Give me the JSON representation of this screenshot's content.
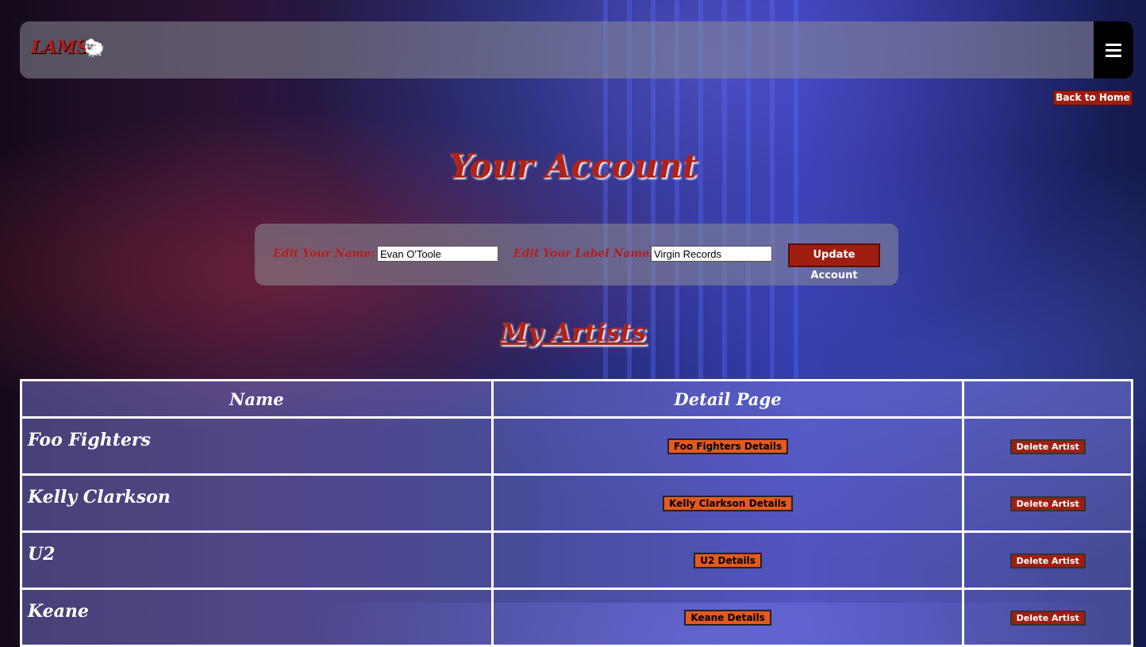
{
  "header": {
    "brand": "LAMS",
    "brand_icon": "sheep-icon",
    "back_label": "Back to Home"
  },
  "page": {
    "title": "Your Account",
    "section_title": "My Artists"
  },
  "form": {
    "name_label": "Edit Your Name:",
    "name_value": "Evan O'Toole",
    "label_label": "Edit Your Label Name:",
    "label_value": "Virgin Records",
    "submit_label": "Update Account"
  },
  "table": {
    "headers": [
      "Name",
      "Detail Page",
      ""
    ],
    "rows": [
      {
        "name": "Foo Fighters",
        "detail": "Foo Fighters Details",
        "delete": "Delete Artist"
      },
      {
        "name": "Kelly Clarkson",
        "detail": "Kelly Clarkson Details",
        "delete": "Delete Artist"
      },
      {
        "name": "U2",
        "detail": "U2 Details",
        "delete": "Delete Artist"
      },
      {
        "name": "Keane",
        "detail": "Keane Details",
        "delete": "Delete Artist"
      }
    ]
  },
  "colors": {
    "accent": "#9e1f12",
    "detail_button": "#e4591f",
    "brand": "#b01e1e"
  }
}
